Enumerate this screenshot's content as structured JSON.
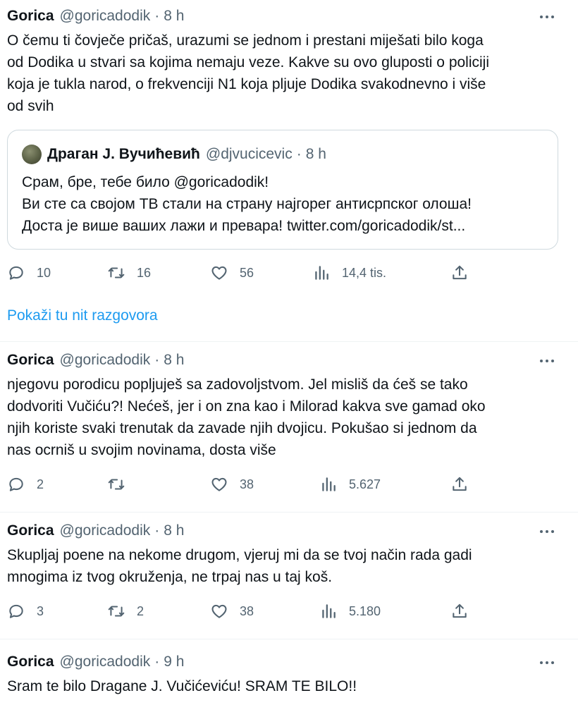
{
  "tweets": [
    {
      "name": "Gorica",
      "handle": "@goricadodik",
      "dot": "·",
      "time": "8 h",
      "lines": [
        "O čemu ti čovječe pričaš, urazumi se jednom i prestani miješati bilo koga",
        "od Dodika u stvari sa kojima nemaju veze. Kakve su ovo gluposti o policiji",
        "koja je tukla narod, o frekvenciji N1 koja pljuje Dodika svakodnevno i više",
        "od svih"
      ],
      "quote": {
        "name": "Драган Ј. Вучићевић",
        "handle": "@djvucicevic",
        "dot": "·",
        "time": "8 h",
        "lines": [
          "Срам, бре, тебе било @goricadodik!",
          "Ви сте са својом ТВ стали на страну најгорег антисрпског олоша!",
          "Доста је више ваших лажи и превара! twitter.com/goricadodik/st..."
        ]
      },
      "replies": "10",
      "retweets": "16",
      "likes": "56",
      "views": "14,4 tis."
    },
    {
      "name": "Gorica",
      "handle": "@goricadodik",
      "dot": "·",
      "time": "8 h",
      "lines": [
        "njegovu porodicu popljuješ sa zadovoljstvom. Jel misliš da ćeš se tako",
        "dodvoriti Vučiću?! Nećeš, jer i on zna kao i Milorad kakva sve gamad oko",
        "njih koriste svaki trenutak da zavade njih dvojicu. Pokušao si jednom da",
        "nas ocrniš u svojim novinama, dosta više"
      ],
      "replies": "2",
      "retweets": "",
      "likes": "38",
      "views": "5.627"
    },
    {
      "name": "Gorica",
      "handle": "@goricadodik",
      "dot": "·",
      "time": "8 h",
      "lines": [
        "Skupljaj poene na nekome drugom, vjeruj mi da se tvoj način rada gadi",
        "mnogima iz tvog okruženja, ne trpaj nas u taj koš."
      ],
      "replies": "3",
      "retweets": "2",
      "likes": "38",
      "views": "5.180"
    },
    {
      "name": "Gorica",
      "handle": "@goricadodik",
      "dot": "·",
      "time": "9 h",
      "lines": [
        "Sram te bilo Dragane J. Vučićeviću! SRAM TE BILO!!"
      ]
    }
  ],
  "show_thread": "Pokaži tu nit razgovora",
  "icons": {
    "reply": "reply-icon",
    "retweet": "retweet-icon",
    "like": "heart-icon",
    "views": "views-icon",
    "share": "share-icon",
    "more": "more-icon"
  },
  "colors": {
    "text": "#0f1419",
    "secondary": "#536471",
    "link": "#1d9bf0",
    "border": "#cfd9de",
    "separator": "#eff3f4"
  }
}
